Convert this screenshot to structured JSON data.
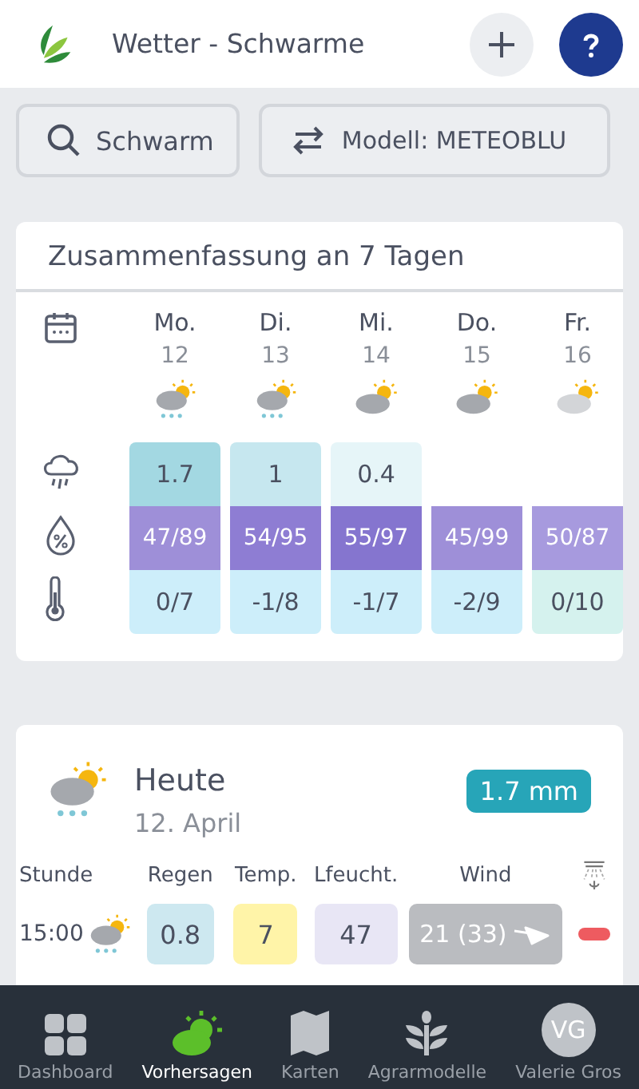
{
  "header": {
    "title": "Wetter - Schwarme"
  },
  "toolbar": {
    "search": "Schwarm",
    "model": "Modell: METEOBLU"
  },
  "summary": {
    "title": "Zusammenfassung an 7 Tagen",
    "days": [
      {
        "day": "Mo.",
        "date": "12",
        "kind": "snow",
        "rain": {
          "value": "1.7",
          "color": "#a3d8e2"
        },
        "humidity": {
          "value": "47/89",
          "color": "#9e8fd8"
        },
        "temp": {
          "value": "0/7",
          "color": "#cdeefa"
        }
      },
      {
        "day": "Di.",
        "date": "13",
        "kind": "snow",
        "rain": {
          "value": "1",
          "color": "#c6e7ef"
        },
        "humidity": {
          "value": "54/95",
          "color": "#8e7dd3"
        },
        "temp": {
          "value": "-1/8",
          "color": "#cdeefa"
        }
      },
      {
        "day": "Mi.",
        "date": "14",
        "kind": "cloudy",
        "rain": {
          "value": "0.4",
          "color": "#e6f5f8"
        },
        "humidity": {
          "value": "55/97",
          "color": "#8575cf"
        },
        "temp": {
          "value": "-1/7",
          "color": "#cdeefa"
        }
      },
      {
        "day": "Do.",
        "date": "15",
        "kind": "cloudy",
        "humidity": {
          "value": "45/99",
          "color": "#9e8fd8"
        },
        "temp": {
          "value": "-2/9",
          "color": "#cdeefa"
        }
      },
      {
        "day": "Fr.",
        "date": "16",
        "kind": "light",
        "humidity": {
          "value": "50/87",
          "color": "#a79ade"
        },
        "temp": {
          "value": "0/10",
          "color": "#d5f2ee"
        }
      }
    ]
  },
  "today": {
    "title": "Heute",
    "date": "12. April",
    "total": "1.7 mm",
    "columns": [
      "Stunde",
      "Regen",
      "Temp.",
      "Lfeucht.",
      "Wind"
    ],
    "hours": [
      {
        "time": "15:00",
        "rain": "0.8",
        "temp": "7",
        "humidity": "47",
        "wind": "21 (33)",
        "irrigation": false
      }
    ]
  },
  "nav": [
    {
      "label": "Dashboard",
      "kind": "grid",
      "selected": false
    },
    {
      "label": "Vorhersagen",
      "kind": "weather",
      "selected": true
    },
    {
      "label": "Karten",
      "kind": "map",
      "selected": false
    },
    {
      "label": "Agrarmodelle",
      "kind": "plant",
      "selected": false
    },
    {
      "label": "Valerie Gros",
      "kind": "avatar",
      "initials": "VG",
      "selected": false
    }
  ]
}
